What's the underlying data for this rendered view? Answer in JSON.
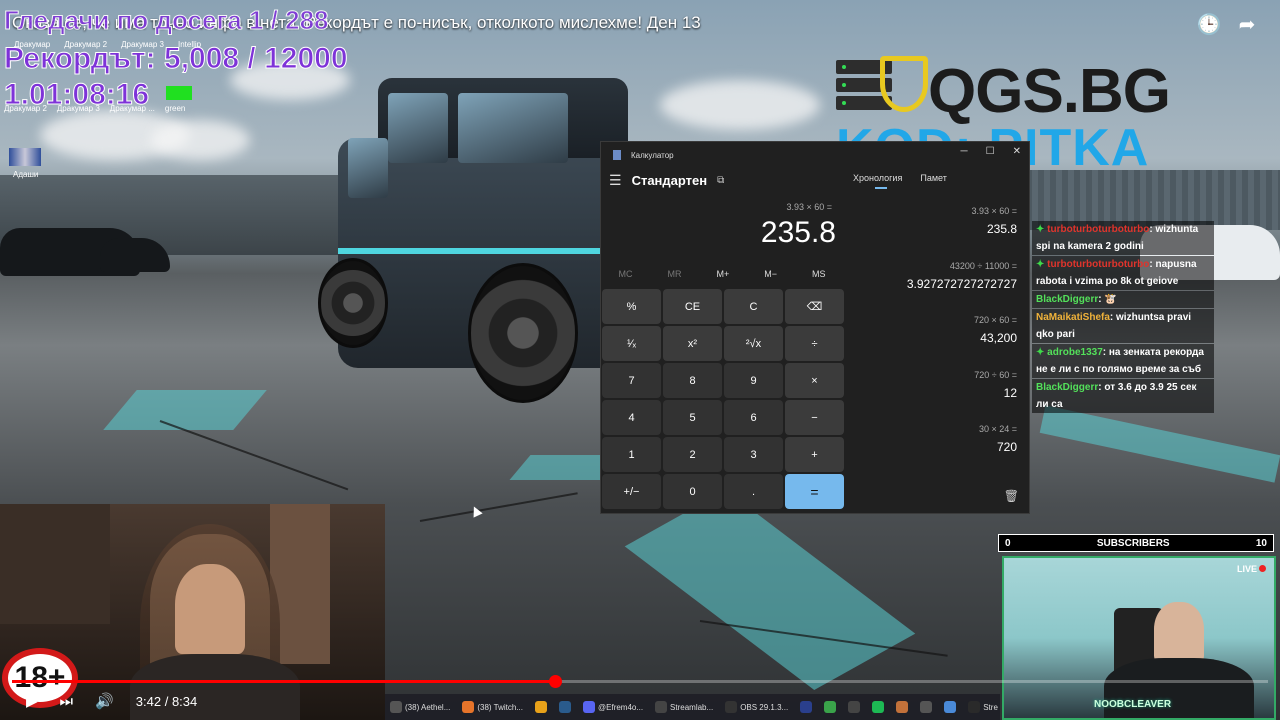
{
  "video": {
    "title": "Оказа се, че има точно инфо в нета. Рекордът е по-нисък, отколкото мислехме! Ден 13",
    "current_time": "3:42",
    "duration": "8:34",
    "time_separator": "/",
    "progress": 0.432
  },
  "stream_overlay": {
    "line1": "Гледачи по досега 1 / 288",
    "line2": "Рекордът: 5,008 / 12000",
    "timer": "1.01:08:16",
    "desktop_labels": [
      "Дракумар",
      "Дракумар 2",
      "Дракумар 3",
      "Intellip"
    ],
    "desktop_labels2": [
      "Дракумар 2",
      "Дракумар 3",
      "Дракумар ...",
      "green"
    ],
    "desktop_icon_label": "Адаши",
    "age_rating": "18+"
  },
  "sponsor": {
    "brand": "QGS.BG",
    "code": "KOD: PITKA"
  },
  "calculator": {
    "window_title": "Калкулатор",
    "mode": "Стандартен",
    "expression": "3.93 × 60 =",
    "result": "235.8",
    "memory_buttons": [
      {
        "label": "MC",
        "enabled": false
      },
      {
        "label": "MR",
        "enabled": false
      },
      {
        "label": "M+",
        "enabled": true
      },
      {
        "label": "M−",
        "enabled": true
      },
      {
        "label": "MS",
        "enabled": true
      }
    ],
    "keys": [
      "%",
      "CE",
      "C",
      "⌫",
      "¹⁄ₓ",
      "x²",
      "²√x",
      "÷",
      "7",
      "8",
      "9",
      "×",
      "4",
      "5",
      "6",
      "−",
      "1",
      "2",
      "3",
      "+",
      "+/−",
      "0",
      ".",
      "="
    ],
    "tabs": [
      "Хронология",
      "Памет"
    ],
    "history": [
      {
        "expr": "3.93   ×   60 =",
        "result": "235.8"
      },
      {
        "expr": "43200   ÷   11000 =",
        "result": "3.927272727272727"
      },
      {
        "expr": "720   ×   60 =",
        "result": "43,200"
      },
      {
        "expr": "720   ÷   60 =",
        "result": "12"
      },
      {
        "expr": "30   ×   24 =",
        "result": "720"
      }
    ]
  },
  "chat": [
    {
      "user": "turboturboturboturbo",
      "text": ": wizhunta spi na kamera 2 godini",
      "color": "#e0342c",
      "badge": true
    },
    {
      "user": "turboturboturboturbo",
      "text": ": napusna rabota i vzima po 8k ot geiove",
      "color": "#e0342c",
      "badge": true
    },
    {
      "user": "BlackDiggerr",
      "text": ": 🐮",
      "color": "#53e05a",
      "badge": false
    },
    {
      "user": "NaMaikatiShefa",
      "text": ": wizhuntsa pravi qko pari",
      "color": "#f0b23a",
      "badge": false
    },
    {
      "user": "adrobe1337",
      "text": ": на зенката рекорда не е ли с по голямо време за съб",
      "color": "#53e05a",
      "badge": true
    },
    {
      "user": "BlackDiggerr",
      "text": ": от 3.6 до 3.9 25 сек ли са",
      "color": "#53e05a",
      "badge": false
    }
  ],
  "subscribers": {
    "left": "0",
    "label": "SUBSCRIBERS",
    "right": "10"
  },
  "webcam": {
    "live": "LIVE",
    "name": "NOOBCLEAVER"
  },
  "taskbar": [
    {
      "label": "(38) Aethel...",
      "color": "#555"
    },
    {
      "label": "(38) Twitch...",
      "color": "#e6742a"
    },
    {
      "label": "",
      "color": "#e8a21a"
    },
    {
      "label": "",
      "color": "#2a5b8c"
    },
    {
      "label": "@Efrem4o...",
      "color": "#5865f2"
    },
    {
      "label": "Streamlab...",
      "color": "#444"
    },
    {
      "label": "OBS 29.1.3...",
      "color": "#333"
    },
    {
      "label": "",
      "color": "#2a3f8c"
    },
    {
      "label": "",
      "color": "#3aa34a"
    },
    {
      "label": "",
      "color": "#444"
    },
    {
      "label": "",
      "color": "#1db954"
    },
    {
      "label": "",
      "color": "#c2713a"
    },
    {
      "label": "",
      "color": "#555"
    },
    {
      "label": "",
      "color": "#4a8ad8"
    },
    {
      "label": "Stre",
      "color": "#2a2a2a"
    }
  ]
}
